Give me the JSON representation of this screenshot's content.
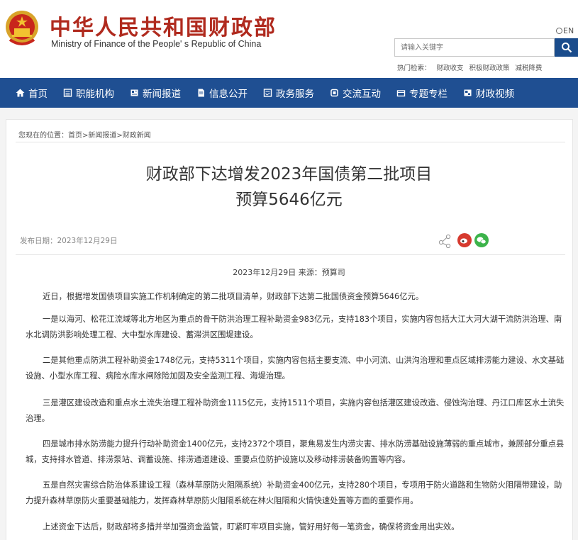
{
  "header": {
    "title_cn": "中华人民共和国财政部",
    "title_en": "Ministry of Finance of the People' s Republic of China",
    "lang": "EN",
    "search_placeholder": "请输入关键字",
    "hot_label": "热门检索：",
    "hot_words": [
      "财政收支",
      "积极财政政策",
      "减税降费"
    ]
  },
  "nav": {
    "items": [
      {
        "label": "首页",
        "icon": "home-icon"
      },
      {
        "label": "职能机构",
        "icon": "book-icon"
      },
      {
        "label": "新闻报道",
        "icon": "newspaper-icon"
      },
      {
        "label": "信息公开",
        "icon": "document-icon"
      },
      {
        "label": "政务服务",
        "icon": "service-icon"
      },
      {
        "label": "交流互动",
        "icon": "chat-icon"
      },
      {
        "label": "专题专栏",
        "icon": "folder-icon"
      },
      {
        "label": "财政视频",
        "icon": "video-icon"
      }
    ]
  },
  "breadcrumb": "您现在的位置：首页>新闻报道>财政新闻",
  "article": {
    "title_line1": "财政部下达增发2023年国债第二批项目",
    "title_line2": "预算5646亿元",
    "publish_date": "发布日期：2023年12月29日",
    "source": "2023年12月29日 来源：预算司",
    "paragraphs": [
      "近日，根据增发国债项目实施工作机制确定的第二批项目清单，财政部下达第二批国债资金预算5646亿元。",
      "一是以海河、松花江流域等北方地区为重点的骨干防洪治理工程补助资金983亿元，支持183个项目，实施内容包括大江大河大湖干流防洪治理、南水北调防洪影响处理工程、大中型水库建设、蓄滞洪区围堤建设。",
      "二是其他重点防洪工程补助资金1748亿元，支持5311个项目，实施内容包括主要支流、中小河流、山洪沟治理和重点区域排涝能力建设、水文基础设施、小型水库工程、病险水库水闸除险加固及安全监测工程、海堤治理。",
      "三是灌区建设改造和重点水土流失治理工程补助资金1115亿元，支持1511个项目，实施内容包括灌区建设改造、侵蚀沟治理、丹江口库区水土流失治理。",
      "四是城市排水防涝能力提升行动补助资金1400亿元，支持2372个项目，聚焦易发生内涝灾害、排水防涝基础设施薄弱的重点城市，兼顾部分重点县城，支持排水管道、排涝泵站、调蓄设施、排涝通道建设、重要点位防护设施以及移动排涝装备购置等内容。",
      "五是自然灾害综合防治体系建设工程（森林草原防火阻隔系统）补助资金400亿元，支持280个项目，专项用于防火道路和生物防火阻隔带建设，助力提升森林草原防火重要基础能力，发挥森林草原防火阻隔系统在林火阻隔和火情快速处置等方面的重要作用。",
      "上述资金下达后，财政部将多措并举加强资金监管，盯紧盯牢项目实施，管好用好每一笔资金，确保将资金用出实效。"
    ]
  },
  "colors": {
    "brand_red": "#b02a1e",
    "nav_blue": "#1f4f92",
    "weibo": "#d63a2f",
    "wechat": "#3cb34a"
  }
}
